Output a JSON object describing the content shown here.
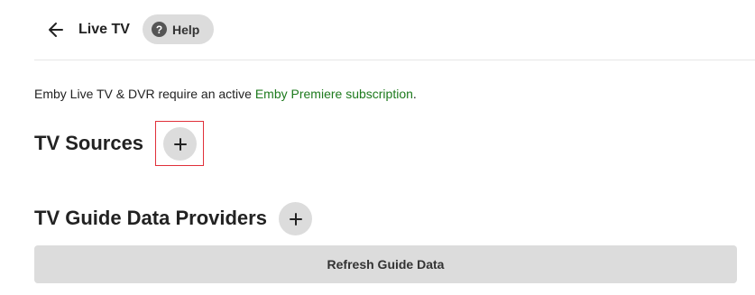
{
  "header": {
    "back_icon": "arrow-left-icon",
    "title": "Live TV",
    "help": {
      "icon": "question-circle-icon",
      "icon_glyph": "?",
      "label": "Help"
    }
  },
  "notice": {
    "text_before": "Emby Live TV & DVR require an active ",
    "link_text": "Emby Premiere subscription",
    "text_after": "."
  },
  "sections": {
    "tv_sources": {
      "title": "TV Sources",
      "add_icon": "plus-icon"
    },
    "guide_providers": {
      "title": "TV Guide Data Providers",
      "add_icon": "plus-icon"
    }
  },
  "refresh_button": {
    "label": "Refresh Guide Data"
  },
  "colors": {
    "link": "#1d7a1d",
    "button_bg": "#dcdcdc",
    "highlight": "#e0303a"
  }
}
